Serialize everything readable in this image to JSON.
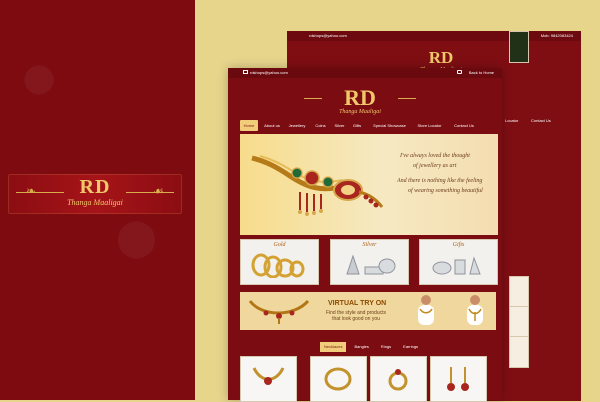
{
  "left_logo": {
    "main": "RD",
    "sub": "Thanga Maaligai"
  },
  "back_site": {
    "email": "rdshops@yahoo.com",
    "phone": "Mob: 9842083424",
    "nav": [
      "Locator",
      "Contact Us"
    ]
  },
  "front_site": {
    "email": "rdshops@yahoo.com",
    "phone": "Back to Home",
    "logo": {
      "main": "RD",
      "sub": "Thanga Maaligai"
    },
    "nav": [
      "Home",
      "About us",
      "Jewellery",
      "Coins",
      "Silver",
      "Gifts",
      "Special Showcase",
      "Store Locator",
      "Contact Us"
    ],
    "hero": {
      "line1": "I've always loved the thought",
      "line2": "of jewellery as art",
      "line3": "And there is nothing like the feeling",
      "line4": "of wearing something beautiful"
    },
    "categories": [
      "Gold",
      "Silver",
      "Gifts"
    ],
    "virtual": {
      "title": "VIRTUAL TRY ON",
      "subtitle": "Find the style and products that look good on you"
    },
    "tabs": [
      "Necklaces",
      "Bangles",
      "Rings",
      "Earrings"
    ]
  }
}
